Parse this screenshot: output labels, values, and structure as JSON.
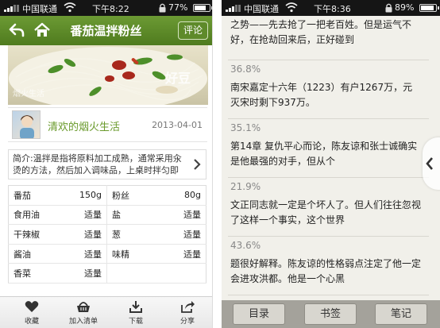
{
  "left_screen": {
    "status": {
      "carrier": "中国联通",
      "time": "下午8:22",
      "battery": "77%",
      "battery_level": 0.77
    },
    "header": {
      "title": "番茄温拌粉丝",
      "comment_label": "评论"
    },
    "image": {
      "watermark": "好豆",
      "watermark_small": "烟火生活"
    },
    "author": {
      "name": "清欢的烟火生活",
      "date": "2013-04-01"
    },
    "intro": {
      "text": "简介:温拌是指将原料加工成熟，通常采用汆烫的方法，然后加入调味品，上桌时拌匀即可"
    },
    "ingredients": [
      {
        "name": "番茄",
        "amount": "150g",
        "name2": "粉丝",
        "amount2": "80g"
      },
      {
        "name": "食用油",
        "amount": "适量",
        "name2": "盐",
        "amount2": "适量"
      },
      {
        "name": "干辣椒",
        "amount": "适量",
        "name2": "葱",
        "amount2": "适量"
      },
      {
        "name": "酱油",
        "amount": "适量",
        "name2": "味精",
        "amount2": "适量"
      },
      {
        "name": "香菜",
        "amount": "适量",
        "name2": "",
        "amount2": ""
      }
    ],
    "toolbar": {
      "favorite": "收藏",
      "add_list": "加入清单",
      "download": "下载",
      "share": "分享"
    }
  },
  "right_screen": {
    "status": {
      "carrier": "中国联通",
      "time": "下午8:36",
      "battery": "89%",
      "battery_level": 0.89
    },
    "notes": [
      {
        "percent": "",
        "text": "之势——先去抢了一把老百姓。但是运气不好，在抢劫回来后，正好碰到"
      },
      {
        "percent": "36.8%",
        "text": "南宋嘉定十六年（1223）有户1267万，元灭宋时剩下937万。"
      },
      {
        "percent": "35.1%",
        "text": "第14章 复仇平心而论，陈友谅和张士诚确实是他最强的对手，但从个"
      },
      {
        "percent": "21.9%",
        "text": "文正同志就一定是个坏人了。但人们往往忽视了这样一个事实，这个世界"
      },
      {
        "percent": "43.6%",
        "text": "题很好解释。陈友谅的性格弱点注定了他一定会进攻洪都。他是一个心黑"
      }
    ],
    "toolbar": {
      "toc": "目录",
      "bookmark": "书签",
      "notes": "笔记"
    }
  }
}
